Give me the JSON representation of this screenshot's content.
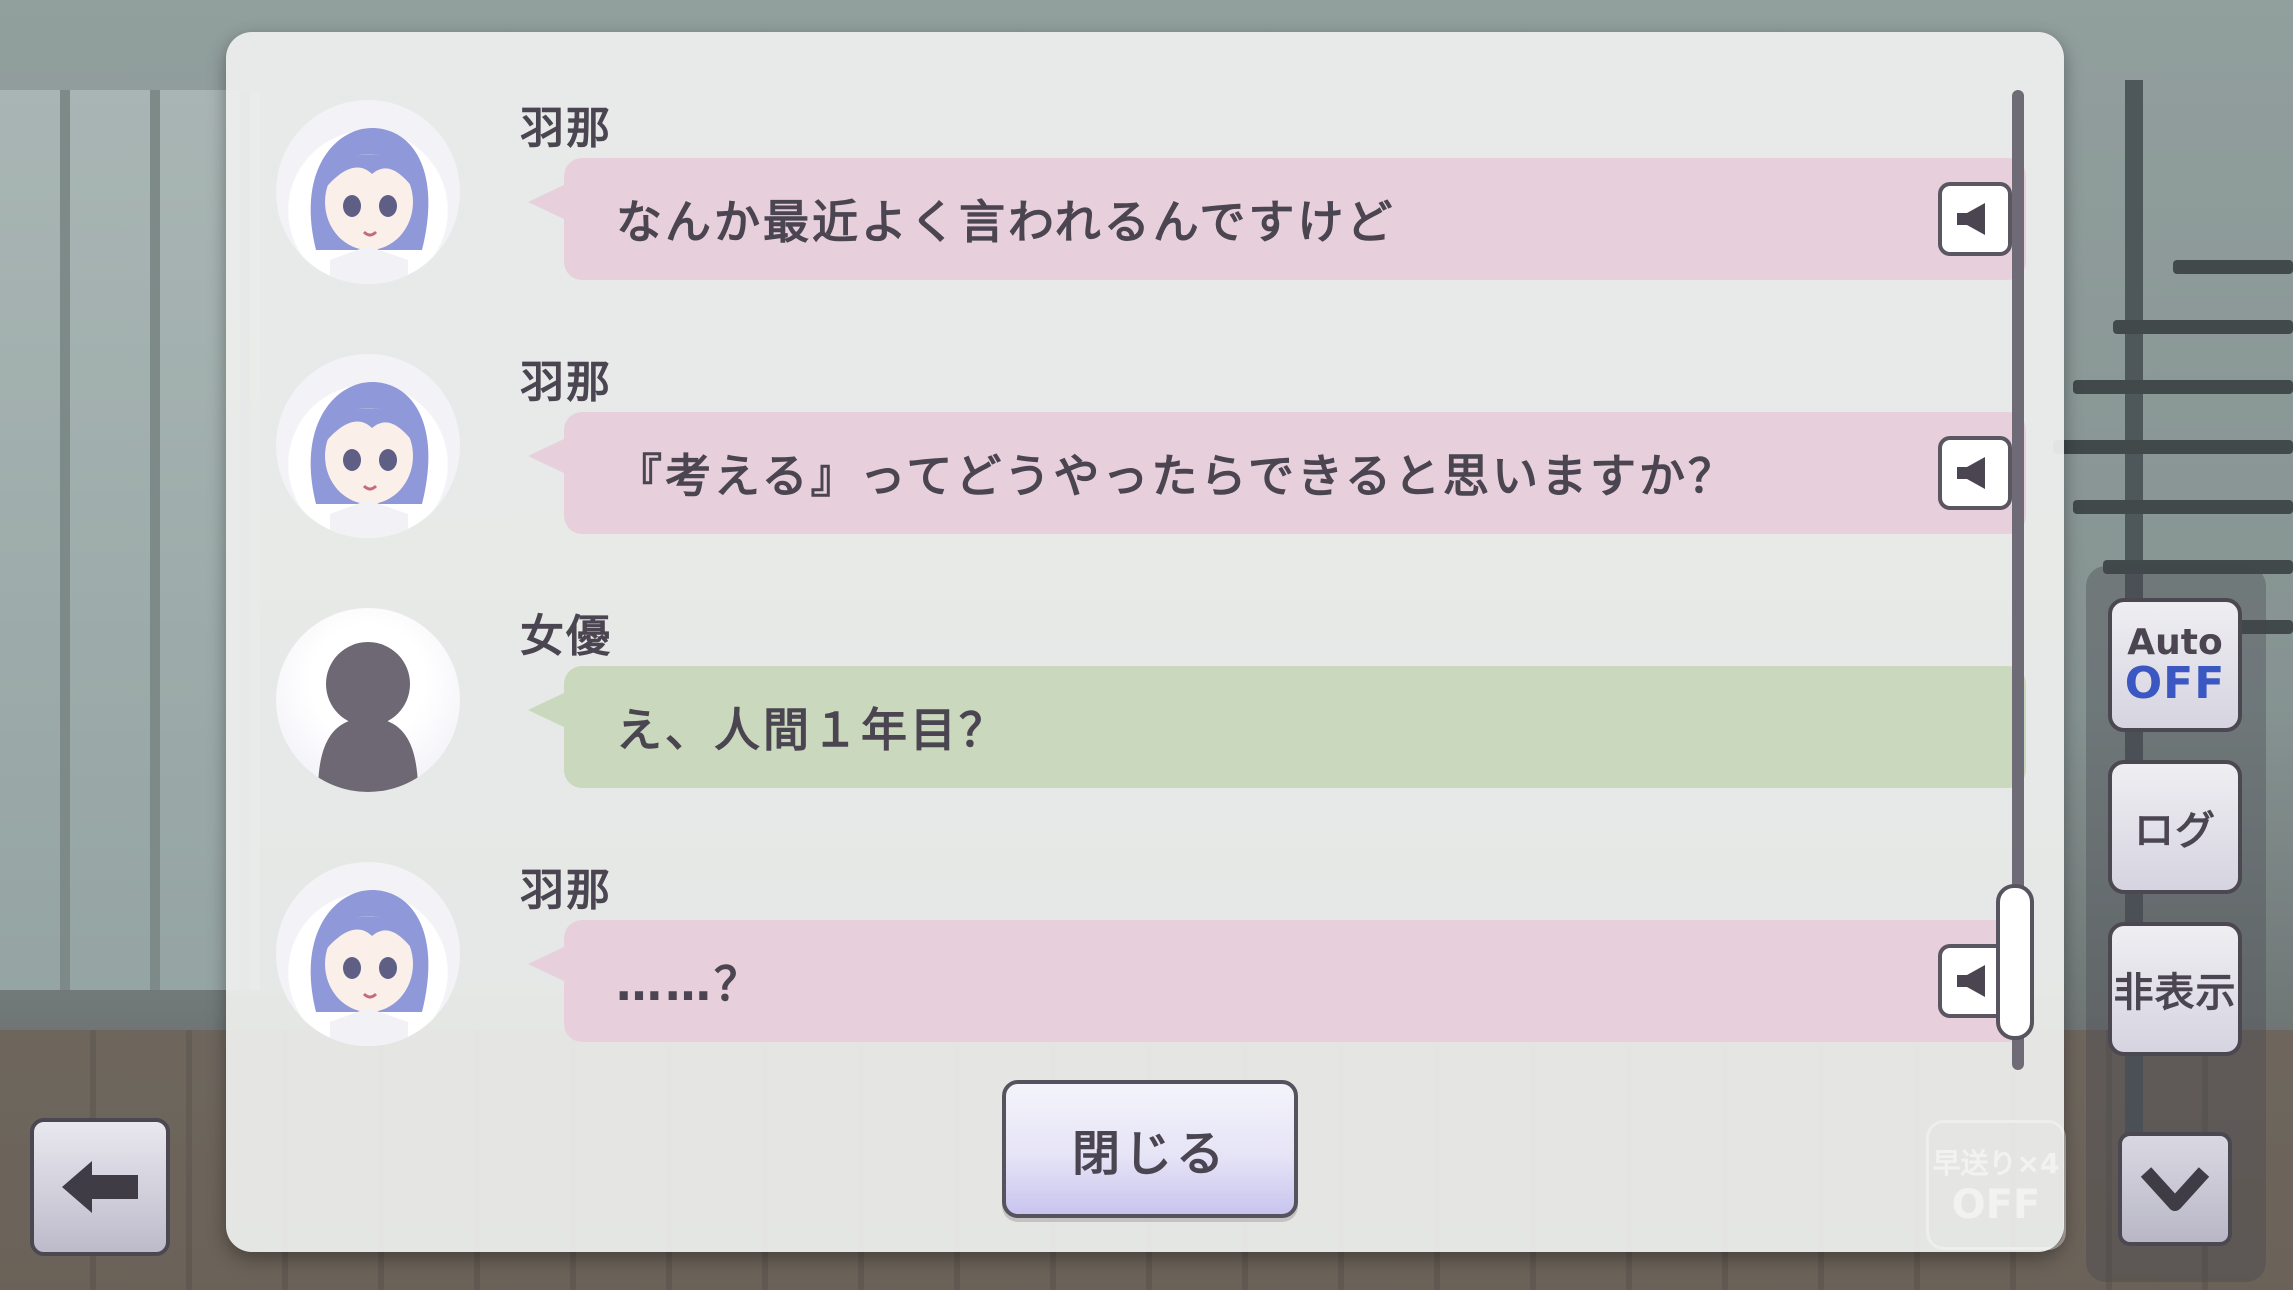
{
  "log": {
    "entries": [
      {
        "speaker": "羽那",
        "text": "なんか最近よく言われるんですけど",
        "bubble": "pink",
        "avatar": "hana-portrait-icon",
        "has_voice": true
      },
      {
        "speaker": "羽那",
        "text": "『考える』ってどうやったらできると思いますか？",
        "bubble": "pink",
        "avatar": "hana-portrait-icon",
        "has_voice": true
      },
      {
        "speaker": "女優",
        "text": "え、人間１年目？",
        "bubble": "green",
        "avatar": "silhouette-icon",
        "has_voice": false
      },
      {
        "speaker": "羽那",
        "text": "……？",
        "bubble": "pink",
        "avatar": "hana-portrait-icon",
        "has_voice": true
      }
    ],
    "close_label": "閉じる",
    "scroll_position": 1.0
  },
  "controls": {
    "auto_label": "Auto",
    "auto_state": "OFF",
    "log_label": "ログ",
    "hide_label": "非表示",
    "fast_forward_label": "早送り×4",
    "fast_forward_state": "OFF"
  },
  "icons": {
    "voice": "speaker-icon",
    "back": "arrow-left-icon",
    "down": "chevron-down-icon"
  },
  "colors": {
    "bubble_pink": "#e7d0dc",
    "bubble_green": "#cad8bd",
    "auto_off": "#3a57c2",
    "text": "#4a4550"
  }
}
